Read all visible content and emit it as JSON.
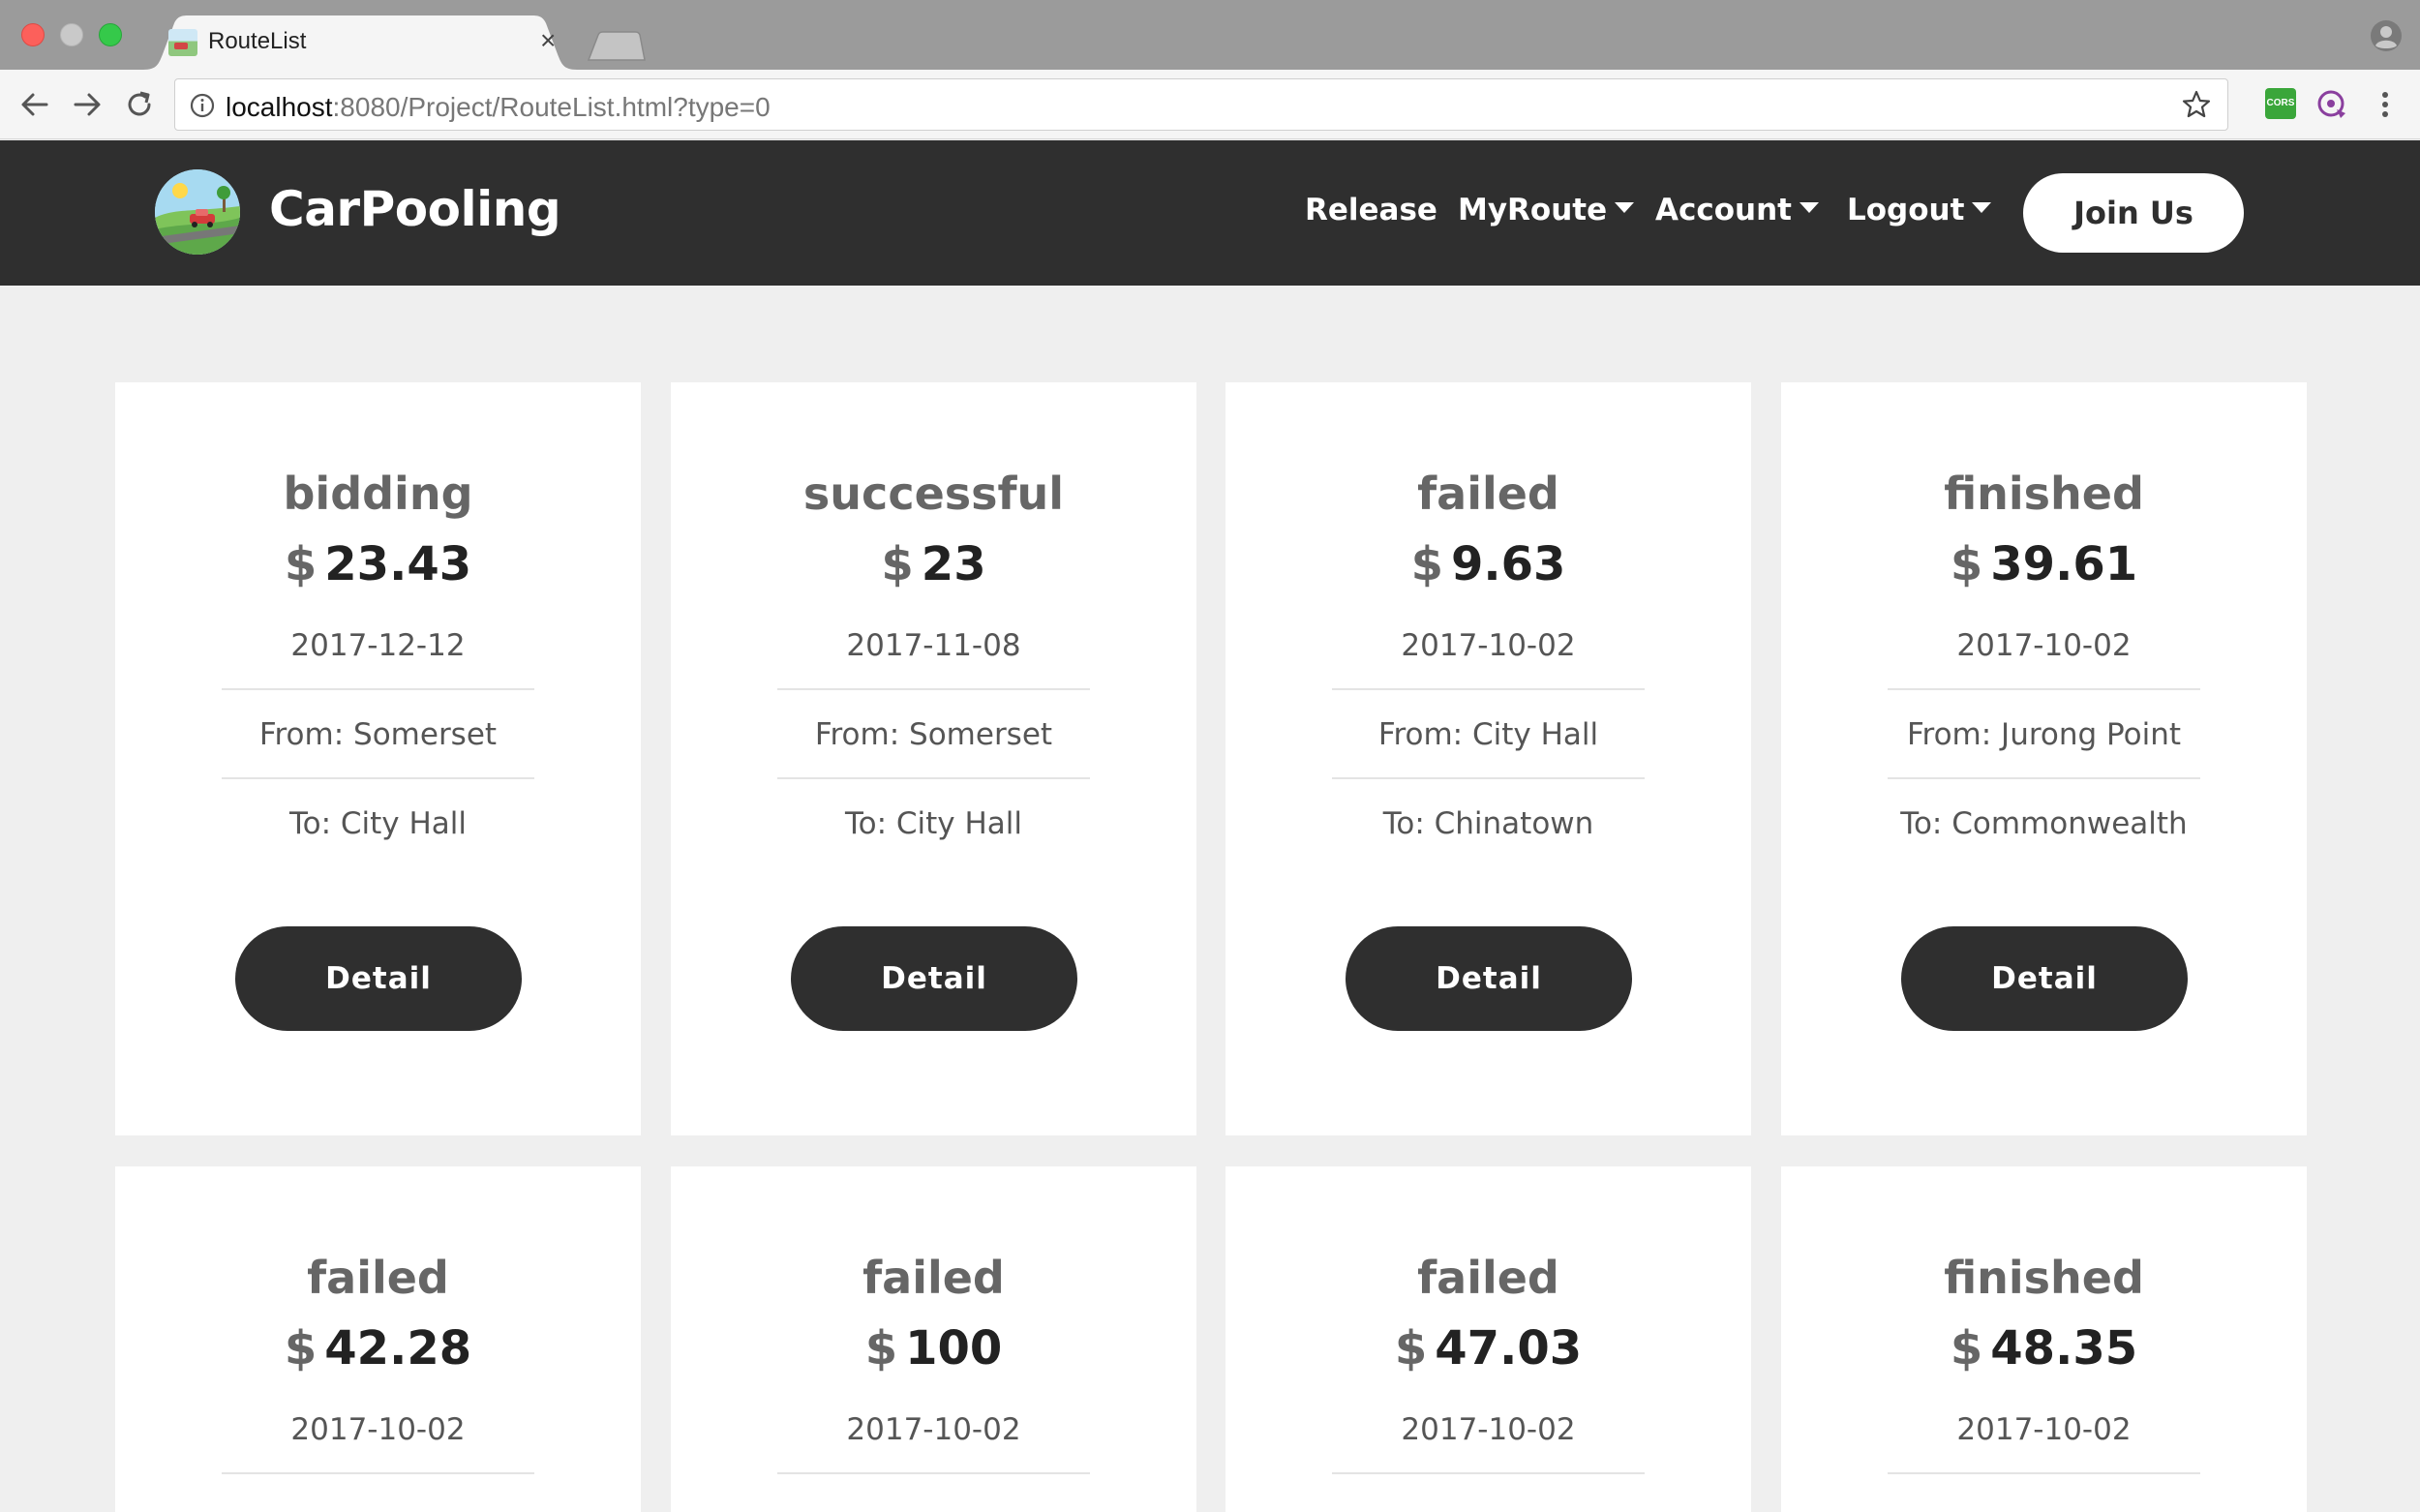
{
  "browser": {
    "tab_title": "RouteList",
    "tab_close": "×",
    "url_host": "localhost",
    "url_path": ":8080/Project/RouteList.html?type=0",
    "cors_badge": "CORS"
  },
  "header": {
    "brand": "CarPooling",
    "nav": {
      "release": "Release",
      "myroute": "MyRoute",
      "account": "Account",
      "logout": "Logout"
    },
    "join_label": "Join Us"
  },
  "currency": "$",
  "cards": [
    {
      "status": "bidding",
      "price": "23.43",
      "date": "2017-12-12",
      "from": "From: Somerset",
      "to": "To: City Hall",
      "button": "Detail"
    },
    {
      "status": "successful",
      "price": "23",
      "date": "2017-11-08",
      "from": "From: Somerset",
      "to": "To: City Hall",
      "button": "Detail"
    },
    {
      "status": "failed",
      "price": "9.63",
      "date": "2017-10-02",
      "from": "From: City Hall",
      "to": "To: Chinatown",
      "button": "Detail"
    },
    {
      "status": "finished",
      "price": "39.61",
      "date": "2017-10-02",
      "from": "From: Jurong Point",
      "to": "To: Commonwealth",
      "button": "Detail"
    },
    {
      "status": "failed",
      "price": "42.28",
      "date": "2017-10-02"
    },
    {
      "status": "failed",
      "price": "100",
      "date": "2017-10-02"
    },
    {
      "status": "failed",
      "price": "47.03",
      "date": "2017-10-02"
    },
    {
      "status": "finished",
      "price": "48.35",
      "date": "2017-10-02"
    }
  ]
}
